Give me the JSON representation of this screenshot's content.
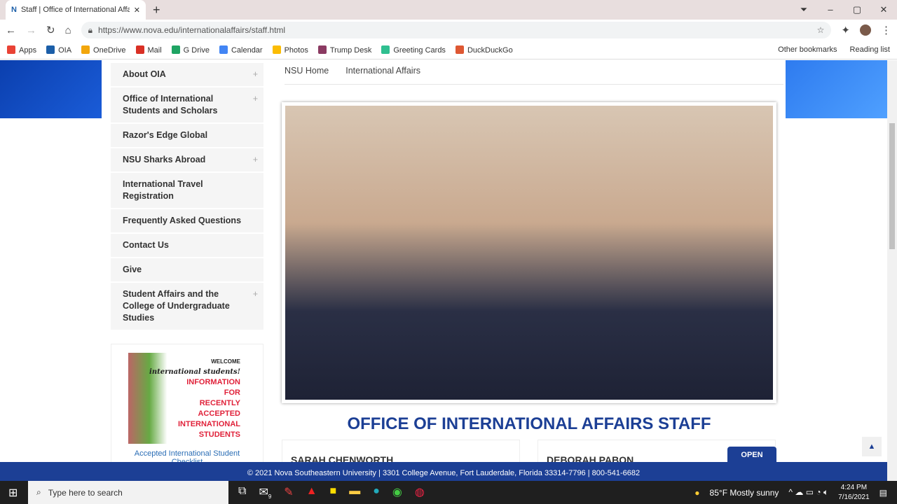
{
  "browser": {
    "tab_title": "Staff | Office of International Affairs",
    "url": "https://www.nova.edu/internationalaffairs/staff.html",
    "bookmarks": [
      {
        "label": "Apps",
        "color": "#e94235"
      },
      {
        "label": "OIA",
        "color": "#1b5ea8"
      },
      {
        "label": "OneDrive",
        "color": "#f2a60c"
      },
      {
        "label": "Mail",
        "color": "#d93025"
      },
      {
        "label": "G Drive",
        "color": "#1fa463"
      },
      {
        "label": "Calendar",
        "color": "#4285f4"
      },
      {
        "label": "Photos",
        "color": "#fbbc04"
      },
      {
        "label": "Trump Desk",
        "color": "#8b3a62"
      },
      {
        "label": "Greeting Cards",
        "color": "#2fbf90"
      },
      {
        "label": "DuckDuckGo",
        "color": "#de5833"
      }
    ],
    "other_bookmarks": "Other bookmarks",
    "reading_list": "Reading list"
  },
  "sidebar": {
    "items": [
      {
        "label": "About OIA",
        "plus": true
      },
      {
        "label": "Office of International Students and Scholars",
        "plus": true
      },
      {
        "label": "Razor's Edge Global",
        "plus": false
      },
      {
        "label": "NSU Sharks Abroad",
        "plus": true
      },
      {
        "label": "International Travel Registration",
        "plus": false
      },
      {
        "label": "Frequently Asked Questions",
        "plus": false
      },
      {
        "label": "Contact Us",
        "plus": false
      },
      {
        "label": "Give",
        "plus": false
      },
      {
        "label": "Student Affairs and the College of Undergraduate Studies",
        "plus": true
      }
    ],
    "promo": {
      "welcome": "WELCOME",
      "script": "international students!",
      "lines": [
        "INFORMATION",
        "FOR",
        "RECENTLY",
        "ACCEPTED",
        "INTERNATIONAL",
        "STUDENTS"
      ],
      "link": "Accepted International Student Checklist"
    }
  },
  "breadcrumb": [
    "NSU Home",
    "International Affairs"
  ],
  "main": {
    "title": "OFFICE OF INTERNATIONAL AFFAIRS STAFF",
    "staff": [
      "SARAH CHENWORTH",
      "DEBORAH PABON"
    ],
    "open_label": "OPEN"
  },
  "footer": "© 2021 Nova Southeastern University | 3301 College Avenue, Fort Lauderdale, Florida 33314-7796 | 800-541-6682",
  "taskbar": {
    "search_placeholder": "Type here to search",
    "weather": "85°F  Mostly sunny",
    "time": "4:24 PM",
    "date": "7/16/2021",
    "mail_badge": "9"
  }
}
